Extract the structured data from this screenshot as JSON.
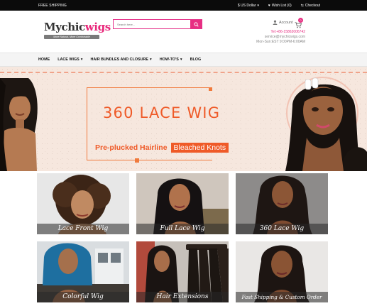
{
  "topbar": {
    "free_shipping": "FREE SHIPPING",
    "currency": "$ US Dollar",
    "wishlist": "Wish List (0)",
    "checkout": "Checkout"
  },
  "header": {
    "logo_part1": "Mychic",
    "logo_part2": "wigs",
    "logo_tagline": "More Natural, More Comfortable",
    "search_placeholder": "Search here...",
    "account": "Account",
    "cart_count": "0",
    "phone": "Tel:+86-15863006742",
    "email": "service@mychicwigs.com",
    "hours": "Mon-Sun:EST 9:00PM-6:00AM"
  },
  "nav": {
    "items": [
      {
        "label": "HOME",
        "dropdown": false
      },
      {
        "label": "LACE WIGS",
        "dropdown": true
      },
      {
        "label": "HAIR BUNDLES AND CLOSURE",
        "dropdown": true
      },
      {
        "label": "HOW-TO'S",
        "dropdown": true
      },
      {
        "label": "BLOG",
        "dropdown": false
      }
    ]
  },
  "banner": {
    "title": "360 LACE WIG",
    "subtitle": "Pre-plucked Hairline",
    "highlight": "Bleached Knots"
  },
  "tiles": [
    {
      "caption": "Lace Front Wig"
    },
    {
      "caption": "Full Lace Wig"
    },
    {
      "caption": "360 Lace Wig"
    },
    {
      "caption": "Colorful Wig"
    },
    {
      "caption": "Hair Extensions"
    },
    {
      "caption": "Fast Shipping & Custom Order"
    }
  ],
  "colors": {
    "brand_pink": "#e72f82",
    "banner_orange": "#ef5a28",
    "topbar": "#0b0b0b"
  }
}
